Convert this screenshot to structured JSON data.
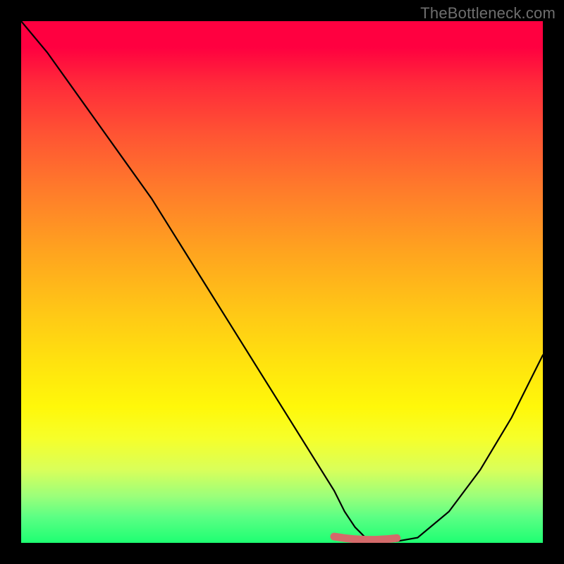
{
  "watermark": "TheBottleneck.com",
  "colors": {
    "frame": "#000000",
    "gradient_top": "#ff0040",
    "gradient_bottom": "#1eff72",
    "curve": "#000000",
    "highlight": "#d46a6a"
  },
  "chart_data": {
    "type": "line",
    "title": "",
    "xlabel": "",
    "ylabel": "",
    "xlim": [
      0,
      100
    ],
    "ylim": [
      0,
      100
    ],
    "grid": false,
    "series": [
      {
        "name": "curve",
        "x": [
          0,
          5,
          10,
          15,
          20,
          25,
          30,
          35,
          40,
          45,
          50,
          55,
          60,
          62,
          64,
          66,
          68,
          70,
          72,
          76,
          82,
          88,
          94,
          100
        ],
        "values": [
          100,
          94,
          87,
          80,
          73,
          66,
          58,
          50,
          42,
          34,
          26,
          18,
          10,
          6,
          3,
          1,
          0.3,
          0.2,
          0.3,
          1,
          6,
          14,
          24,
          36
        ]
      },
      {
        "name": "highlight_segment",
        "x": [
          60,
          62,
          64,
          66,
          68,
          70,
          72
        ],
        "values": [
          1.2,
          0.9,
          0.7,
          0.6,
          0.6,
          0.7,
          0.9
        ]
      }
    ]
  }
}
